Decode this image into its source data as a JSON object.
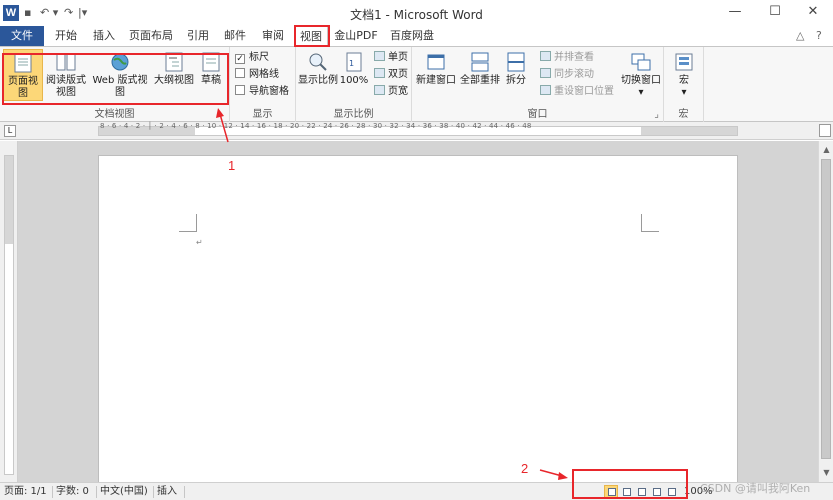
{
  "titlebar": {
    "app_icon": "W",
    "title": "文档1 - Microsoft Word",
    "quick_access": [
      "save-icon",
      "undo-icon",
      "redo-icon",
      "customize-icon"
    ],
    "qa_glyphs": [
      "▪",
      "↶ ▾",
      "↷",
      "|▾"
    ],
    "window_controls": [
      "minimize-icon",
      "maximize-icon",
      "close-icon"
    ],
    "wc_glyphs": [
      "—",
      "☐",
      "✕"
    ]
  },
  "tabs": {
    "file": "文件",
    "items": [
      "开始",
      "插入",
      "页面布局",
      "引用",
      "邮件",
      "审阅",
      "视图",
      "金山PDF",
      "百度网盘"
    ],
    "active": "视图",
    "right_icons": [
      "△",
      "?"
    ]
  },
  "ribbon": {
    "doc_views": {
      "label": "文档视图",
      "buttons": [
        {
          "label": "页面视图",
          "icon": "page-view-icon",
          "selected": true
        },
        {
          "label": "阅读版式\n视图",
          "icon": "reading-view-icon",
          "selected": false
        },
        {
          "label": "Web 版式视图",
          "icon": "web-view-icon",
          "selected": false
        },
        {
          "label": "大纲视图",
          "icon": "outline-view-icon",
          "selected": false
        },
        {
          "label": "草稿",
          "icon": "draft-view-icon",
          "selected": false
        }
      ]
    },
    "show": {
      "label": "显示",
      "items": [
        {
          "label": "标尺",
          "checked": true
        },
        {
          "label": "网格线",
          "checked": false
        },
        {
          "label": "导航窗格",
          "checked": false
        }
      ]
    },
    "zoom": {
      "label": "显示比例",
      "big": [
        {
          "label": "显示比例",
          "icon": "zoom-icon"
        },
        {
          "label": "100%",
          "icon": "zoom-100-icon"
        }
      ],
      "small": [
        "单页",
        "双页",
        "页宽"
      ]
    },
    "window": {
      "label": "窗口",
      "big": [
        {
          "label": "新建窗口",
          "icon": "new-window-icon"
        },
        {
          "label": "全部重排",
          "icon": "arrange-all-icon"
        },
        {
          "label": "拆分",
          "icon": "split-icon"
        }
      ],
      "small": [
        "并排查看",
        "同步滚动",
        "重设窗口位置"
      ],
      "switch": {
        "label": "切换窗口",
        "arrow": "▾"
      }
    },
    "macros": {
      "label": "宏",
      "button": "宏",
      "arrow": "▾"
    }
  },
  "ruler": {
    "tab_selector": "L",
    "numbers": "8 · 6 · 4 · 2 · │ · 2 · 4 · 6 · 8 · 10 · 12 · 14 · 16 · 18 · 20 · 22 · 24 · 26 · 28 · 30 · 32 · 34 · 36 · 38 · 40 · 42 · 44 · 46 · 48"
  },
  "document": {
    "paragraph_mark": "↵"
  },
  "scrollbar": {
    "up": "▲",
    "down": "▼"
  },
  "statusbar": {
    "page": "页面: 1/1",
    "words": "字数: 0",
    "language": "中文(中国)",
    "mode": "插入",
    "zoom": "100%"
  },
  "annotations": {
    "label1": "1",
    "label2": "2",
    "watermark": "CSDN @请叫我阿Ken"
  },
  "colors": {
    "accent": "#2b579a",
    "selected": "#fcd778",
    "annotation_red": "#e8262b"
  }
}
